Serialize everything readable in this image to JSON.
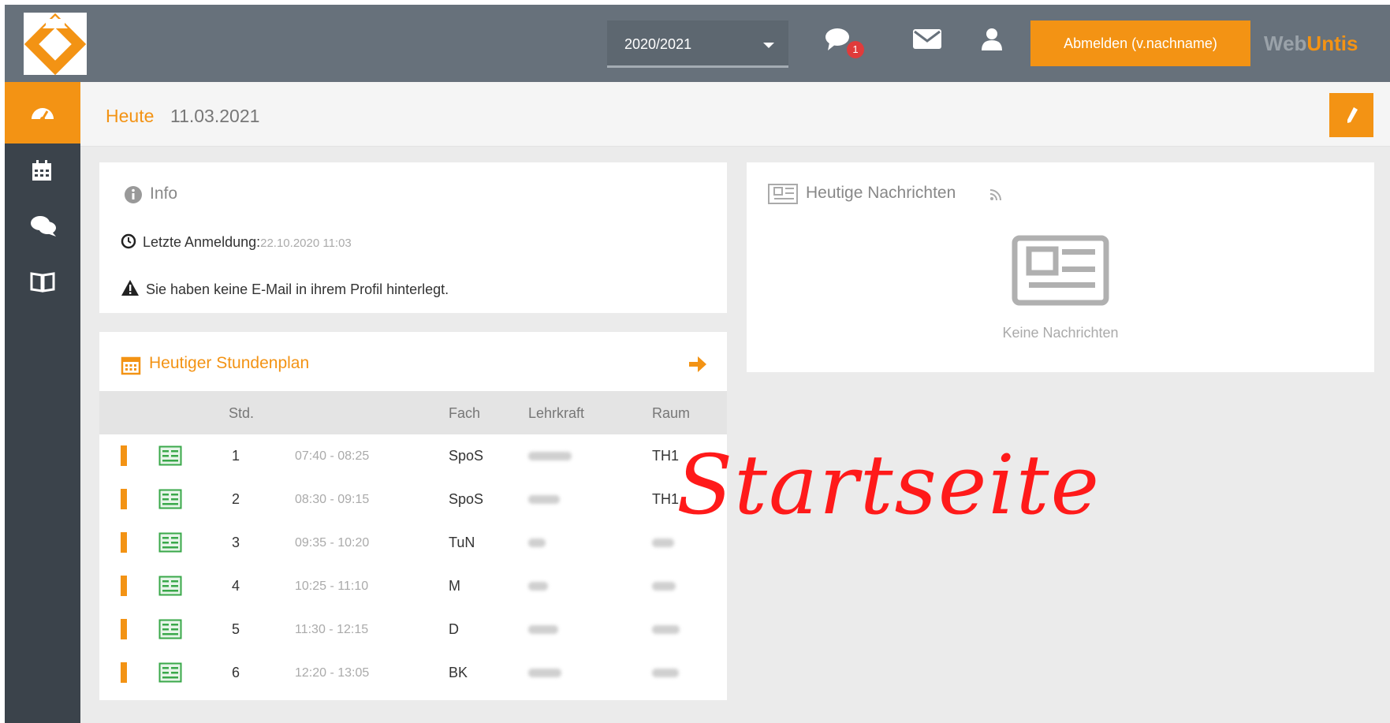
{
  "topbar": {
    "school_year": "2020/2021",
    "chat_badge": "1",
    "logout_label": "Abmelden (v.nachname)",
    "brand_web": "Web",
    "brand_untis": "Untis"
  },
  "sidebar": {
    "items": [
      {
        "name": "dashboard",
        "icon": "dashboard-icon",
        "active": true
      },
      {
        "name": "calendar",
        "icon": "calendar-icon",
        "active": false
      },
      {
        "name": "messages",
        "icon": "chat-icon",
        "active": false
      },
      {
        "name": "classbook",
        "icon": "book-icon",
        "active": false
      }
    ]
  },
  "header": {
    "today_label": "Heute",
    "today_date": "11.03.2021"
  },
  "info": {
    "title": "Info",
    "last_login_label": "Letzte Anmeldung:",
    "last_login_value": "22.10.2020 11:03",
    "warning": "Sie haben keine E-Mail in ihrem Profil hinterlegt."
  },
  "news": {
    "title": "Heutige Nachrichten",
    "empty": "Keine Nachrichten"
  },
  "plan": {
    "title": "Heutiger Stundenplan",
    "columns": {
      "period": "Std.",
      "subject": "Fach",
      "teacher": "Lehrkraft",
      "room": "Raum"
    },
    "rows": [
      {
        "period": "1",
        "time": "07:40 - 08:25",
        "subject": "SpoS",
        "room": "TH1"
      },
      {
        "period": "2",
        "time": "08:30 - 09:15",
        "subject": "SpoS",
        "room": "TH1"
      },
      {
        "period": "3",
        "time": "09:35 - 10:20",
        "subject": "TuN",
        "room": ""
      },
      {
        "period": "4",
        "time": "10:25 - 11:10",
        "subject": "M",
        "room": ""
      },
      {
        "period": "5",
        "time": "11:30 - 12:15",
        "subject": "D",
        "room": ""
      },
      {
        "period": "6",
        "time": "12:20 - 13:05",
        "subject": "BK",
        "room": ""
      }
    ]
  },
  "annotation": "Startseite",
  "colors": {
    "accent": "#f39314",
    "topbar": "#67717b",
    "sidebar": "#3b434b",
    "lesson_icon": "#3aa84a",
    "annotation": "#ff1a1a"
  }
}
